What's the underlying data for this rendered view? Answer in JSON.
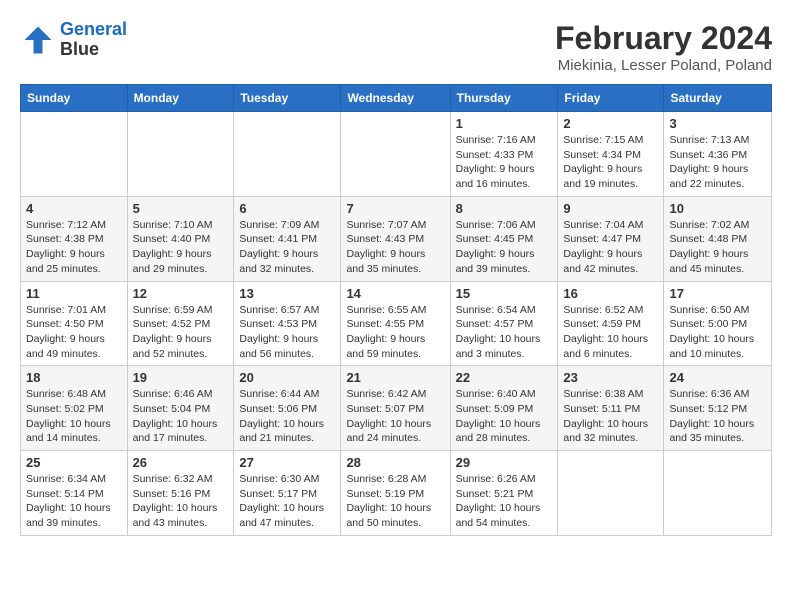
{
  "header": {
    "logo_line1": "General",
    "logo_line2": "Blue",
    "main_title": "February 2024",
    "subtitle": "Miekinia, Lesser Poland, Poland"
  },
  "days_of_week": [
    "Sunday",
    "Monday",
    "Tuesday",
    "Wednesday",
    "Thursday",
    "Friday",
    "Saturday"
  ],
  "weeks": [
    [
      {
        "day": "",
        "sunrise": "",
        "sunset": "",
        "daylight": ""
      },
      {
        "day": "",
        "sunrise": "",
        "sunset": "",
        "daylight": ""
      },
      {
        "day": "",
        "sunrise": "",
        "sunset": "",
        "daylight": ""
      },
      {
        "day": "",
        "sunrise": "",
        "sunset": "",
        "daylight": ""
      },
      {
        "day": "1",
        "sunrise": "Sunrise: 7:16 AM",
        "sunset": "Sunset: 4:33 PM",
        "daylight": "Daylight: 9 hours and 16 minutes."
      },
      {
        "day": "2",
        "sunrise": "Sunrise: 7:15 AM",
        "sunset": "Sunset: 4:34 PM",
        "daylight": "Daylight: 9 hours and 19 minutes."
      },
      {
        "day": "3",
        "sunrise": "Sunrise: 7:13 AM",
        "sunset": "Sunset: 4:36 PM",
        "daylight": "Daylight: 9 hours and 22 minutes."
      }
    ],
    [
      {
        "day": "4",
        "sunrise": "Sunrise: 7:12 AM",
        "sunset": "Sunset: 4:38 PM",
        "daylight": "Daylight: 9 hours and 25 minutes."
      },
      {
        "day": "5",
        "sunrise": "Sunrise: 7:10 AM",
        "sunset": "Sunset: 4:40 PM",
        "daylight": "Daylight: 9 hours and 29 minutes."
      },
      {
        "day": "6",
        "sunrise": "Sunrise: 7:09 AM",
        "sunset": "Sunset: 4:41 PM",
        "daylight": "Daylight: 9 hours and 32 minutes."
      },
      {
        "day": "7",
        "sunrise": "Sunrise: 7:07 AM",
        "sunset": "Sunset: 4:43 PM",
        "daylight": "Daylight: 9 hours and 35 minutes."
      },
      {
        "day": "8",
        "sunrise": "Sunrise: 7:06 AM",
        "sunset": "Sunset: 4:45 PM",
        "daylight": "Daylight: 9 hours and 39 minutes."
      },
      {
        "day": "9",
        "sunrise": "Sunrise: 7:04 AM",
        "sunset": "Sunset: 4:47 PM",
        "daylight": "Daylight: 9 hours and 42 minutes."
      },
      {
        "day": "10",
        "sunrise": "Sunrise: 7:02 AM",
        "sunset": "Sunset: 4:48 PM",
        "daylight": "Daylight: 9 hours and 45 minutes."
      }
    ],
    [
      {
        "day": "11",
        "sunrise": "Sunrise: 7:01 AM",
        "sunset": "Sunset: 4:50 PM",
        "daylight": "Daylight: 9 hours and 49 minutes."
      },
      {
        "day": "12",
        "sunrise": "Sunrise: 6:59 AM",
        "sunset": "Sunset: 4:52 PM",
        "daylight": "Daylight: 9 hours and 52 minutes."
      },
      {
        "day": "13",
        "sunrise": "Sunrise: 6:57 AM",
        "sunset": "Sunset: 4:53 PM",
        "daylight": "Daylight: 9 hours and 56 minutes."
      },
      {
        "day": "14",
        "sunrise": "Sunrise: 6:55 AM",
        "sunset": "Sunset: 4:55 PM",
        "daylight": "Daylight: 9 hours and 59 minutes."
      },
      {
        "day": "15",
        "sunrise": "Sunrise: 6:54 AM",
        "sunset": "Sunset: 4:57 PM",
        "daylight": "Daylight: 10 hours and 3 minutes."
      },
      {
        "day": "16",
        "sunrise": "Sunrise: 6:52 AM",
        "sunset": "Sunset: 4:59 PM",
        "daylight": "Daylight: 10 hours and 6 minutes."
      },
      {
        "day": "17",
        "sunrise": "Sunrise: 6:50 AM",
        "sunset": "Sunset: 5:00 PM",
        "daylight": "Daylight: 10 hours and 10 minutes."
      }
    ],
    [
      {
        "day": "18",
        "sunrise": "Sunrise: 6:48 AM",
        "sunset": "Sunset: 5:02 PM",
        "daylight": "Daylight: 10 hours and 14 minutes."
      },
      {
        "day": "19",
        "sunrise": "Sunrise: 6:46 AM",
        "sunset": "Sunset: 5:04 PM",
        "daylight": "Daylight: 10 hours and 17 minutes."
      },
      {
        "day": "20",
        "sunrise": "Sunrise: 6:44 AM",
        "sunset": "Sunset: 5:06 PM",
        "daylight": "Daylight: 10 hours and 21 minutes."
      },
      {
        "day": "21",
        "sunrise": "Sunrise: 6:42 AM",
        "sunset": "Sunset: 5:07 PM",
        "daylight": "Daylight: 10 hours and 24 minutes."
      },
      {
        "day": "22",
        "sunrise": "Sunrise: 6:40 AM",
        "sunset": "Sunset: 5:09 PM",
        "daylight": "Daylight: 10 hours and 28 minutes."
      },
      {
        "day": "23",
        "sunrise": "Sunrise: 6:38 AM",
        "sunset": "Sunset: 5:11 PM",
        "daylight": "Daylight: 10 hours and 32 minutes."
      },
      {
        "day": "24",
        "sunrise": "Sunrise: 6:36 AM",
        "sunset": "Sunset: 5:12 PM",
        "daylight": "Daylight: 10 hours and 35 minutes."
      }
    ],
    [
      {
        "day": "25",
        "sunrise": "Sunrise: 6:34 AM",
        "sunset": "Sunset: 5:14 PM",
        "daylight": "Daylight: 10 hours and 39 minutes."
      },
      {
        "day": "26",
        "sunrise": "Sunrise: 6:32 AM",
        "sunset": "Sunset: 5:16 PM",
        "daylight": "Daylight: 10 hours and 43 minutes."
      },
      {
        "day": "27",
        "sunrise": "Sunrise: 6:30 AM",
        "sunset": "Sunset: 5:17 PM",
        "daylight": "Daylight: 10 hours and 47 minutes."
      },
      {
        "day": "28",
        "sunrise": "Sunrise: 6:28 AM",
        "sunset": "Sunset: 5:19 PM",
        "daylight": "Daylight: 10 hours and 50 minutes."
      },
      {
        "day": "29",
        "sunrise": "Sunrise: 6:26 AM",
        "sunset": "Sunset: 5:21 PM",
        "daylight": "Daylight: 10 hours and 54 minutes."
      },
      {
        "day": "",
        "sunrise": "",
        "sunset": "",
        "daylight": ""
      },
      {
        "day": "",
        "sunrise": "",
        "sunset": "",
        "daylight": ""
      }
    ]
  ]
}
